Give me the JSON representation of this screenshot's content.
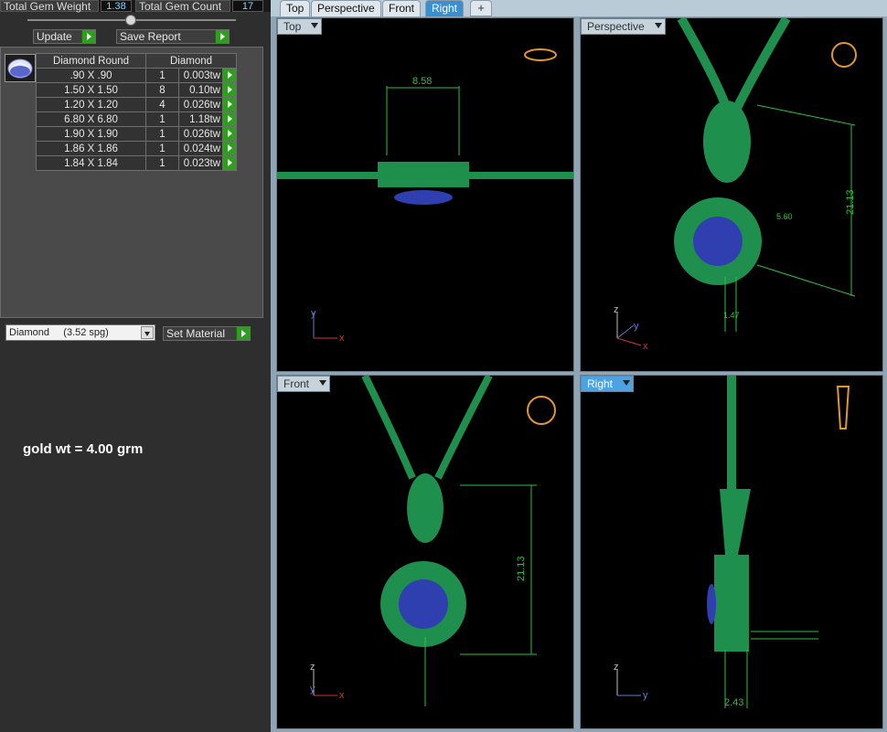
{
  "stats": {
    "gem_weight_label": "Total Gem Weight",
    "gem_weight_value": "1.38",
    "gem_count_label": "Total Gem Count",
    "gem_count_value": "17"
  },
  "buttons": {
    "update": "Update",
    "save_report": "Save Report",
    "set_material": "Set Material"
  },
  "gem_table": {
    "header_shape": "Diamond Round",
    "header_type": "Diamond",
    "rows": [
      {
        "size": ".90 X .90",
        "count": "1",
        "weight": "0.003tw"
      },
      {
        "size": "1.50 X 1.50",
        "count": "8",
        "weight": "0.10tw"
      },
      {
        "size": "1.20 X 1.20",
        "count": "4",
        "weight": "0.026tw"
      },
      {
        "size": "6.80 X 6.80",
        "count": "1",
        "weight": "1.18tw"
      },
      {
        "size": "1.90 X 1.90",
        "count": "1",
        "weight": "0.026tw"
      },
      {
        "size": "1.86 X 1.86",
        "count": "1",
        "weight": "0.024tw"
      },
      {
        "size": "1.84 X 1.84",
        "count": "1",
        "weight": "0.023tw"
      }
    ]
  },
  "material": {
    "selected": "Diamond     (3.52 spg)"
  },
  "note": "gold wt = 4.00 grm",
  "tabs": [
    "Top",
    "Perspective",
    "Front",
    "Right"
  ],
  "active_tab": "Right",
  "plus_tab": "+",
  "viewports": {
    "top": {
      "label": "Top",
      "dimension": "8.58"
    },
    "perspective": {
      "label": "Perspective",
      "dimension_a": "21.13",
      "dimension_b": "5.60",
      "dimension_c": "1.47"
    },
    "front": {
      "label": "Front",
      "dimension": "21.13"
    },
    "right": {
      "label": "Right",
      "dimension": "2.43"
    }
  },
  "axes": {
    "x": "x",
    "y": "y",
    "z": "z"
  },
  "colors": {
    "model_green": "#1f8f4e",
    "stone_blue": "#2f3fb0",
    "dimension_green": "#2fbf3f",
    "active_blue": "#4ba3e3"
  }
}
